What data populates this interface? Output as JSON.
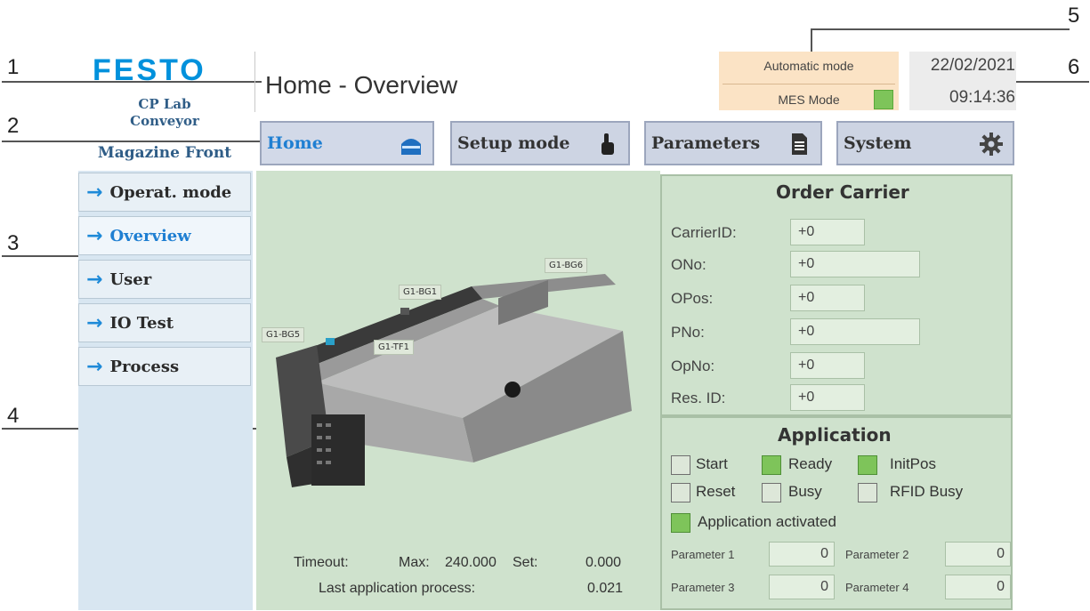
{
  "callouts": [
    "1",
    "2",
    "3",
    "4",
    "5",
    "6"
  ],
  "brand": {
    "logo": "FESTO",
    "station_line1": "CP Lab",
    "station_line2": "Conveyor",
    "station_line3": "Magazine Front"
  },
  "header": {
    "title": "Home - Overview",
    "mode": "Automatic mode",
    "mes_mode": "MES Mode",
    "mes_led_color": "#7ec45a",
    "date": "22/02/2021",
    "time": "09:14:36"
  },
  "nav": [
    {
      "label": "Home",
      "icon": "home-icon"
    },
    {
      "label": "Setup mode",
      "icon": "hand-pointer-icon"
    },
    {
      "label": "Parameters",
      "icon": "document-icon"
    },
    {
      "label": "System",
      "icon": "gear-icon"
    }
  ],
  "sidebar": [
    {
      "label": "Operat. mode"
    },
    {
      "label": "Overview"
    },
    {
      "label": "User"
    },
    {
      "label": "IO Test"
    },
    {
      "label": "Process"
    }
  ],
  "station_image": {
    "labels": [
      "G1-BG6",
      "G1-BG1",
      "G1-BG5",
      "G1-TF1"
    ]
  },
  "timeout": {
    "label": "Timeout:",
    "max_label": "Max:",
    "max_value": "240.000",
    "set_label": "Set:",
    "set_value": "0.000",
    "last_label": "Last application process:",
    "last_value": "0.021"
  },
  "order_carrier": {
    "title": "Order Carrier",
    "fields": [
      {
        "label": "CarrierID:",
        "value": "+0"
      },
      {
        "label": "ONo:",
        "value": "+0"
      },
      {
        "label": "OPos:",
        "value": "+0"
      },
      {
        "label": "PNo:",
        "value": "+0"
      },
      {
        "label": "OpNo:",
        "value": "+0"
      },
      {
        "label": "Res. ID:",
        "value": "+0"
      }
    ]
  },
  "application": {
    "title": "Application",
    "flags": [
      {
        "label": "Start",
        "active": false
      },
      {
        "label": "Ready",
        "active": true
      },
      {
        "label": "InitPos",
        "active": true
      },
      {
        "label": "Reset",
        "active": false
      },
      {
        "label": "Busy",
        "active": false
      },
      {
        "label": "RFID Busy",
        "active": false
      },
      {
        "label": "Application activated",
        "active": true
      }
    ],
    "params": [
      {
        "label": "Parameter 1",
        "value": "0"
      },
      {
        "label": "Parameter 2",
        "value": "0"
      },
      {
        "label": "Parameter 3",
        "value": "0"
      },
      {
        "label": "Parameter 4",
        "value": "0"
      }
    ]
  },
  "colors": {
    "accent_blue": "#1f7fd2",
    "panel_green": "#cfe2cd",
    "led_green": "#7ec45a",
    "mode_orange": "#fbe3c5",
    "sidebar_blue": "#d8e6f1"
  }
}
